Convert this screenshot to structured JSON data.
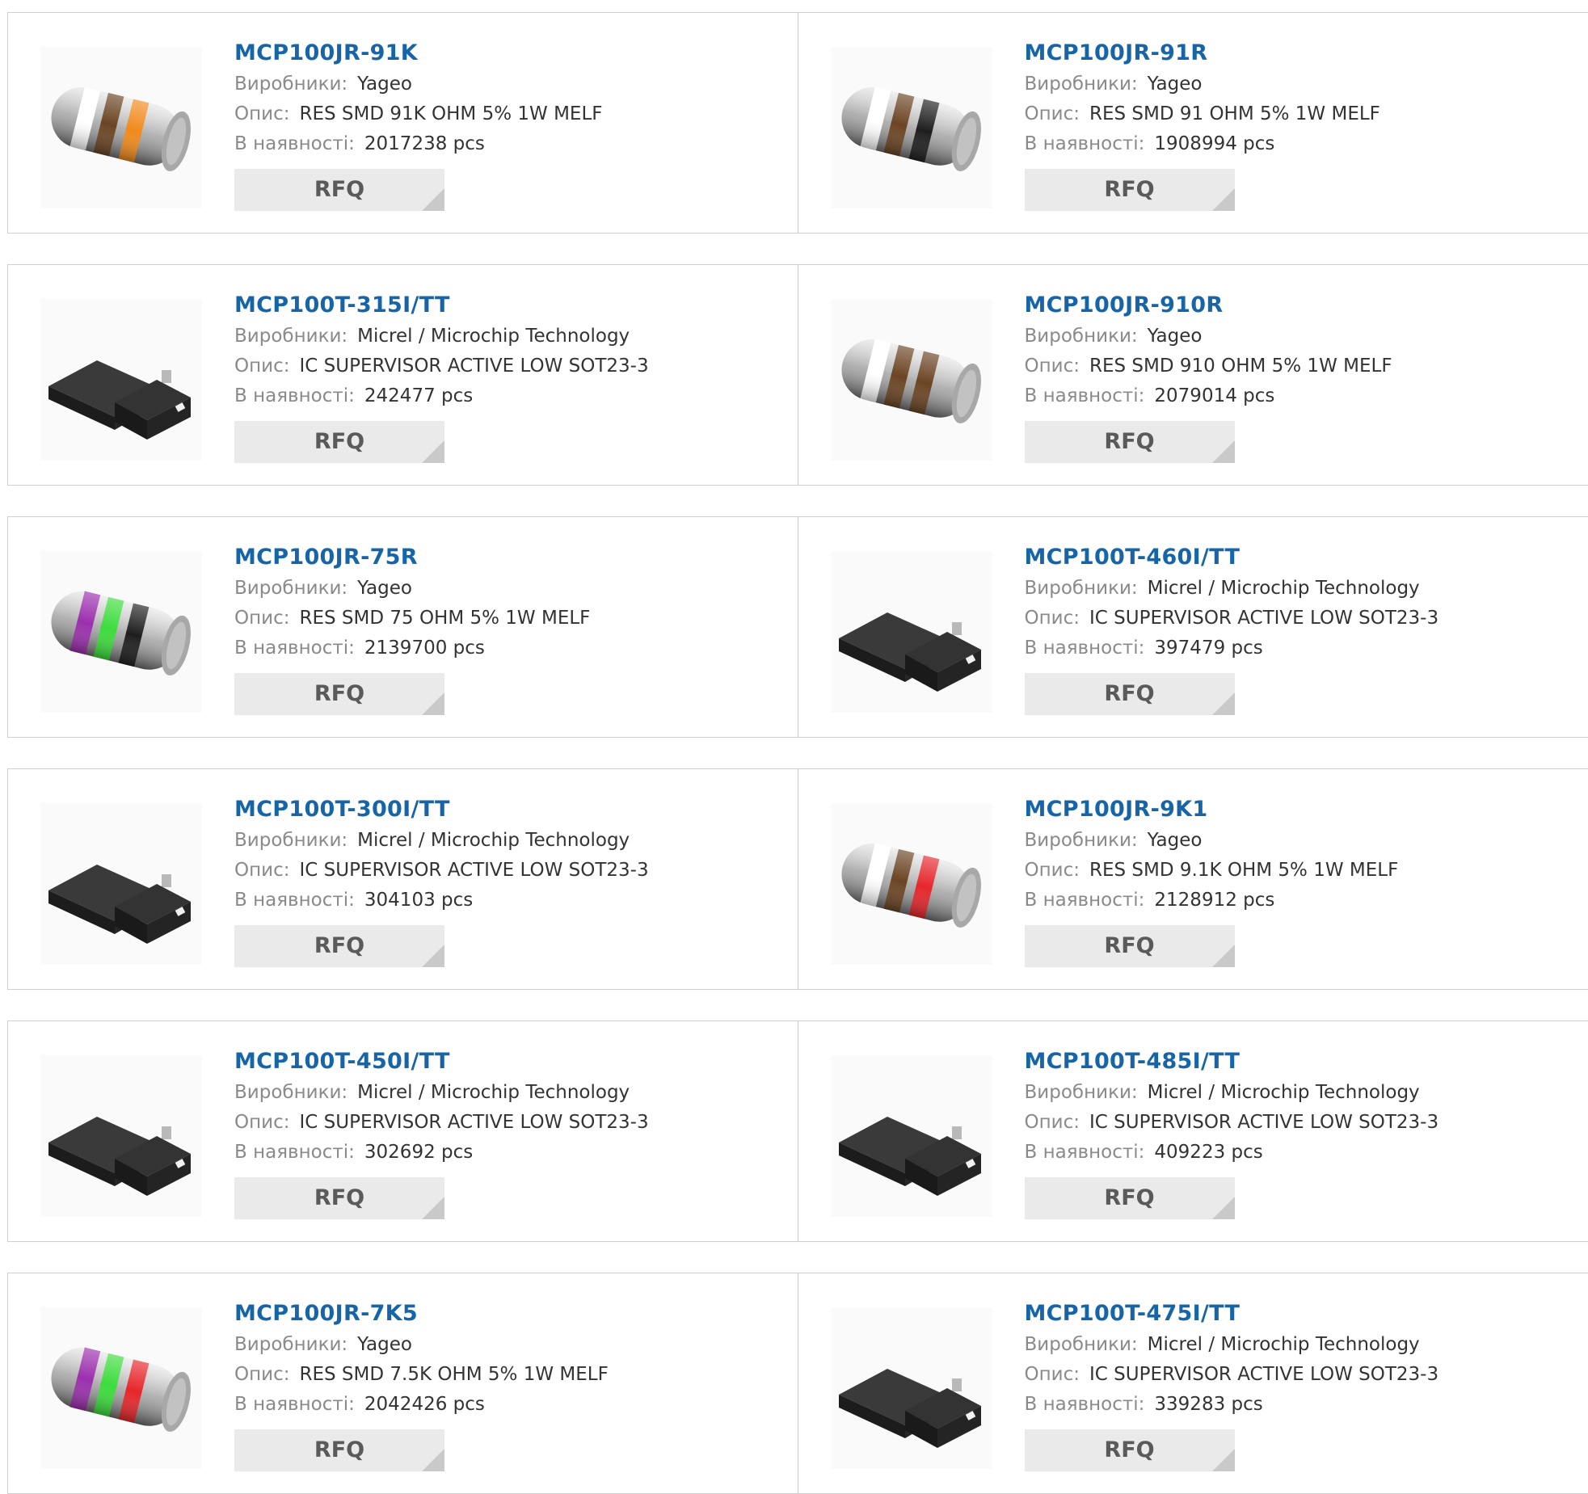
{
  "labels": {
    "manufacturer": "Виробники:",
    "description": "Опис:",
    "stock": "В наявності:",
    "rfq": "RFQ"
  },
  "colors": {
    "part_link": "#1565a8",
    "label": "#8a8a8a",
    "value": "#333333",
    "rfq_bg": "#eaeaea",
    "border": "#cfcfcf"
  },
  "products": [
    {
      "part": "MCP100JR-91K",
      "manufacturer": "Yageo",
      "description": "RES SMD 91K OHM 5% 1W MELF",
      "stock": "2017238 pcs",
      "image": "melf-resistor",
      "bands": [
        "#ffffff",
        "#6b4423",
        "#f08a1c"
      ]
    },
    {
      "part": "MCP100JR-91R",
      "manufacturer": "Yageo",
      "description": "RES SMD 91 OHM 5% 1W MELF",
      "stock": "1908994 pcs",
      "image": "melf-resistor",
      "bands": [
        "#ffffff",
        "#6b4423",
        "#1e1e1e"
      ]
    },
    {
      "part": "MCP100T-315I/TT",
      "manufacturer": "Micrel / Microchip Technology",
      "description": "IC SUPERVISOR ACTIVE LOW SOT23-3",
      "stock": "242477 pcs",
      "image": "sot23-package"
    },
    {
      "part": "MCP100JR-910R",
      "manufacturer": "Yageo",
      "description": "RES SMD 910 OHM 5% 1W MELF",
      "stock": "2079014 pcs",
      "image": "melf-resistor",
      "bands": [
        "#ffffff",
        "#6b4423",
        "#6b4423"
      ]
    },
    {
      "part": "MCP100JR-75R",
      "manufacturer": "Yageo",
      "description": "RES SMD 75 OHM 5% 1W MELF",
      "stock": "2139700 pcs",
      "image": "melf-resistor",
      "bands": [
        "#9b2fae",
        "#3cdc3c",
        "#1e1e1e"
      ]
    },
    {
      "part": "MCP100T-460I/TT",
      "manufacturer": "Micrel / Microchip Technology",
      "description": "IC SUPERVISOR ACTIVE LOW SOT23-3",
      "stock": "397479 pcs",
      "image": "sot23-package"
    },
    {
      "part": "MCP100T-300I/TT",
      "manufacturer": "Micrel / Microchip Technology",
      "description": "IC SUPERVISOR ACTIVE LOW SOT23-3",
      "stock": "304103 pcs",
      "image": "sot23-package"
    },
    {
      "part": "MCP100JR-9K1",
      "manufacturer": "Yageo",
      "description": "RES SMD 9.1K OHM 5% 1W MELF",
      "stock": "2128912 pcs",
      "image": "melf-resistor",
      "bands": [
        "#ffffff",
        "#6b4423",
        "#e6262b"
      ]
    },
    {
      "part": "MCP100T-450I/TT",
      "manufacturer": "Micrel / Microchip Technology",
      "description": "IC SUPERVISOR ACTIVE LOW SOT23-3",
      "stock": "302692 pcs",
      "image": "sot23-package"
    },
    {
      "part": "MCP100T-485I/TT",
      "manufacturer": "Micrel / Microchip Technology",
      "description": "IC SUPERVISOR ACTIVE LOW SOT23-3",
      "stock": "409223 pcs",
      "image": "sot23-package"
    },
    {
      "part": "MCP100JR-7K5",
      "manufacturer": "Yageo",
      "description": "RES SMD 7.5K OHM 5% 1W MELF",
      "stock": "2042426 pcs",
      "image": "melf-resistor",
      "bands": [
        "#9b2fae",
        "#3cdc3c",
        "#e6262b"
      ]
    },
    {
      "part": "MCP100T-475I/TT",
      "manufacturer": "Micrel / Microchip Technology",
      "description": "IC SUPERVISOR ACTIVE LOW SOT23-3",
      "stock": "339283 pcs",
      "image": "sot23-package"
    }
  ]
}
